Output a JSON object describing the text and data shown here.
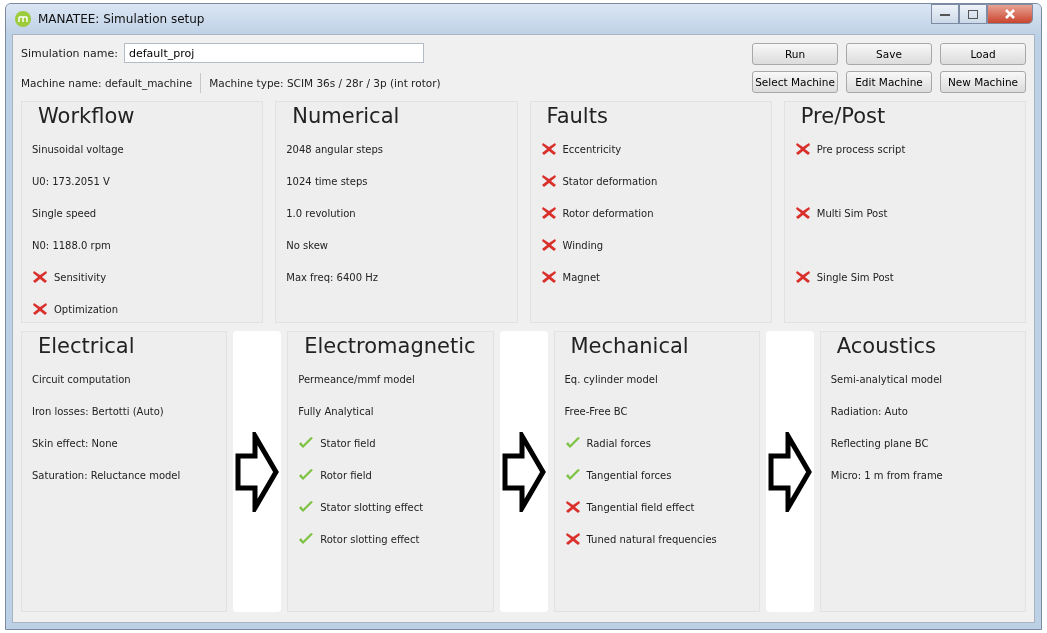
{
  "window": {
    "title": "MANATEE: Simulation setup"
  },
  "simulation_name": {
    "label": "Simulation name:",
    "value": "default_proj"
  },
  "machine_name": "Machine name: default_machine",
  "machine_type": "Machine type: SCIM 36s / 28r / 3p (int rotor)",
  "buttons": [
    [
      "Run",
      "Save",
      "Load"
    ],
    [
      "Select Machine",
      "Edit Machine",
      "New Machine"
    ]
  ],
  "top_panels": [
    {
      "title": "Workflow",
      "items": [
        {
          "kind": "text",
          "label": "Sinusoidal voltage"
        },
        {
          "kind": "text",
          "label": "U0: 173.2051 V"
        },
        {
          "kind": "text",
          "label": "Single speed"
        },
        {
          "kind": "text",
          "label": "N0: 1188.0 rpm"
        },
        {
          "kind": "check",
          "label": "Sensitivity",
          "checked": false
        },
        {
          "kind": "check",
          "label": "Optimization",
          "checked": false
        }
      ]
    },
    {
      "title": "Numerical",
      "items": [
        {
          "kind": "text",
          "label": "2048 angular steps"
        },
        {
          "kind": "text",
          "label": "1024 time steps"
        },
        {
          "kind": "text",
          "label": "1.0 revolution"
        },
        {
          "kind": "text",
          "label": "No skew"
        },
        {
          "kind": "text",
          "label": "Max freq: 6400 Hz"
        }
      ]
    },
    {
      "title": "Faults",
      "items": [
        {
          "kind": "check",
          "label": "Eccentricity",
          "checked": false
        },
        {
          "kind": "check",
          "label": "Stator deformation",
          "checked": false
        },
        {
          "kind": "check",
          "label": "Rotor deformation",
          "checked": false
        },
        {
          "kind": "check",
          "label": "Winding",
          "checked": false
        },
        {
          "kind": "check",
          "label": "Magnet",
          "checked": false
        }
      ]
    },
    {
      "title": "Pre/Post",
      "items": [
        {
          "kind": "check",
          "label": "Pre process script",
          "checked": false
        },
        {
          "kind": "blank"
        },
        {
          "kind": "check",
          "label": "Multi Sim Post",
          "checked": false
        },
        {
          "kind": "blank"
        },
        {
          "kind": "check",
          "label": "Single Sim Post",
          "checked": false
        }
      ]
    }
  ],
  "bottom_panels": [
    {
      "title": "Electrical",
      "items": [
        {
          "kind": "text",
          "label": "Circuit computation"
        },
        {
          "kind": "text",
          "label": "Iron losses: Bertotti (Auto)"
        },
        {
          "kind": "text",
          "label": "Skin effect: None"
        },
        {
          "kind": "text",
          "label": "Saturation: Reluctance model"
        }
      ]
    },
    {
      "title": "Electromagnetic",
      "items": [
        {
          "kind": "text",
          "label": "Permeance/mmf model"
        },
        {
          "kind": "text",
          "label": "Fully Analytical"
        },
        {
          "kind": "check",
          "label": "Stator field",
          "checked": true
        },
        {
          "kind": "check",
          "label": "Rotor field",
          "checked": true
        },
        {
          "kind": "check",
          "label": "Stator slotting effect",
          "checked": true
        },
        {
          "kind": "check",
          "label": "Rotor slotting effect",
          "checked": true
        }
      ]
    },
    {
      "title": "Mechanical",
      "items": [
        {
          "kind": "text",
          "label": "Eq. cylinder model"
        },
        {
          "kind": "text",
          "label": "Free-Free BC"
        },
        {
          "kind": "check",
          "label": "Radial forces",
          "checked": true
        },
        {
          "kind": "check",
          "label": "Tangential forces",
          "checked": true
        },
        {
          "kind": "check",
          "label": "Tangential field effect",
          "checked": false
        },
        {
          "kind": "check",
          "label": "Tuned natural frequencies",
          "checked": false
        }
      ]
    },
    {
      "title": "Acoustics",
      "items": [
        {
          "kind": "text",
          "label": "Semi-analytical model"
        },
        {
          "kind": "text",
          "label": "Radiation: Auto"
        },
        {
          "kind": "text",
          "label": "Reflecting plane BC"
        },
        {
          "kind": "text",
          "label": "Micro: 1 m from frame"
        }
      ]
    }
  ]
}
